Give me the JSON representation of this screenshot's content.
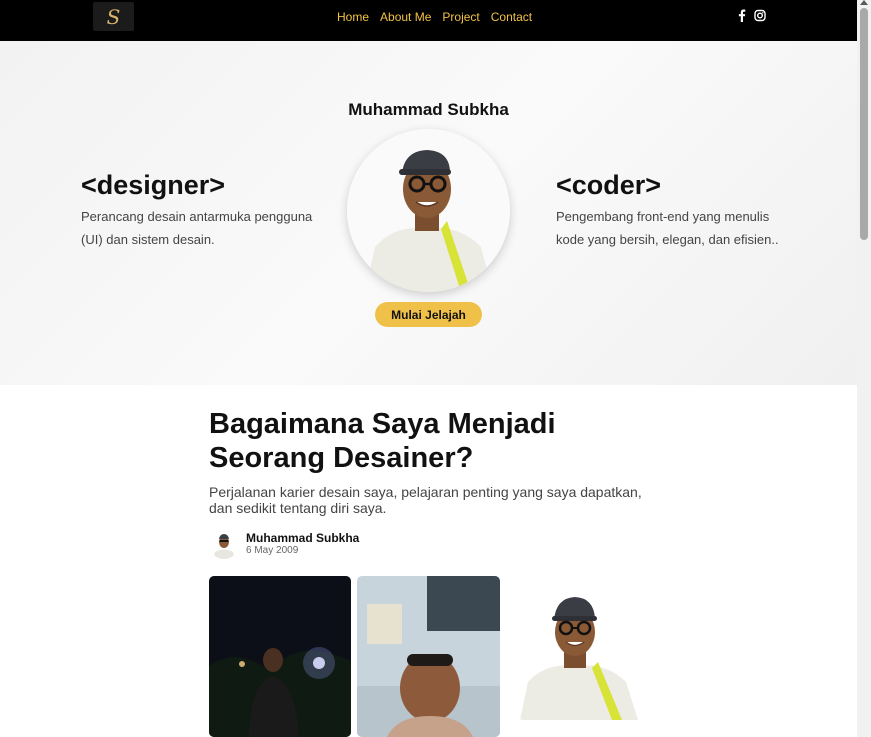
{
  "nav": {
    "logo_glyph": "S",
    "links": [
      "Home",
      "About Me",
      "Project",
      "Contact"
    ],
    "social_icons": [
      "facebook-icon",
      "instagram-icon"
    ],
    "link_color": "#f2c243"
  },
  "hero": {
    "name": "Muhammad Subkha",
    "left": {
      "title": "<designer>",
      "desc": "Perancang desain antarmuka pengguna (UI) dan sistem desain."
    },
    "right": {
      "title": "<coder>",
      "desc": "Pengembang front-end yang menulis kode yang bersih, elegan, dan efisien.."
    },
    "cta": "Mulai Jelajah",
    "accent": "#f0c149"
  },
  "article": {
    "title": "Bagaimana Saya Menjadi Seorang Desainer?",
    "subtitle": "Perjalanan karier desain saya, pelajaran penting yang saya dapatkan, dan sedikit tentang diri saya.",
    "author": "Muhammad Subkha",
    "date": "6 May 2009"
  }
}
